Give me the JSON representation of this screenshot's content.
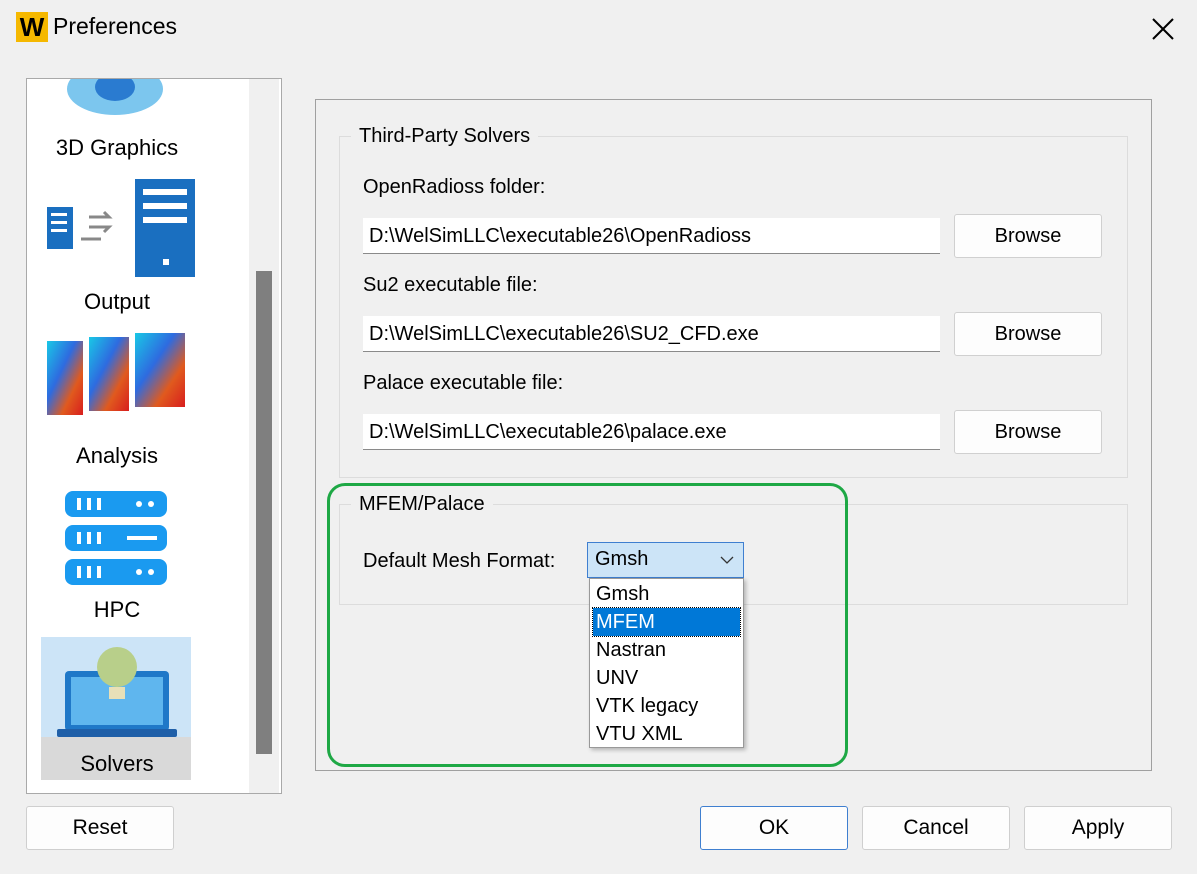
{
  "window": {
    "title": "Preferences",
    "logo_letter": "W"
  },
  "sidebar": {
    "items": [
      {
        "label": "3D Graphics",
        "icon": "3d-graphics-icon"
      },
      {
        "label": "Output",
        "icon": "output-icon"
      },
      {
        "label": "Analysis",
        "icon": "analysis-fem-icon"
      },
      {
        "label": "HPC",
        "icon": "hpc-server-icon"
      },
      {
        "label": "Solvers",
        "icon": "solvers-laptop-icon",
        "selected": true
      }
    ]
  },
  "third_party": {
    "group_title": "Third-Party Solvers",
    "fields": [
      {
        "label": "OpenRadioss folder:",
        "value": "D:\\WelSimLLC\\executable26\\OpenRadioss",
        "button": "Browse"
      },
      {
        "label": "Su2 executable file:",
        "value": "D:\\WelSimLLC\\executable26\\SU2_CFD.exe",
        "button": "Browse"
      },
      {
        "label": "Palace executable file:",
        "value": "D:\\WelSimLLC\\executable26\\palace.exe",
        "button": "Browse"
      }
    ]
  },
  "mfem": {
    "group_title": "MFEM/Palace",
    "mesh_format_label": "Default Mesh Format:",
    "mesh_format_value": "Gmsh",
    "options": [
      "Gmsh",
      "MFEM",
      "Nastran",
      "UNV",
      "VTK legacy",
      "VTU XML"
    ],
    "highlighted_option": "MFEM"
  },
  "footer": {
    "reset": "Reset",
    "ok": "OK",
    "cancel": "Cancel",
    "apply": "Apply"
  },
  "colors": {
    "highlight_border": "#1ea845",
    "selection": "#0078d7",
    "logo": "#f5b800"
  }
}
